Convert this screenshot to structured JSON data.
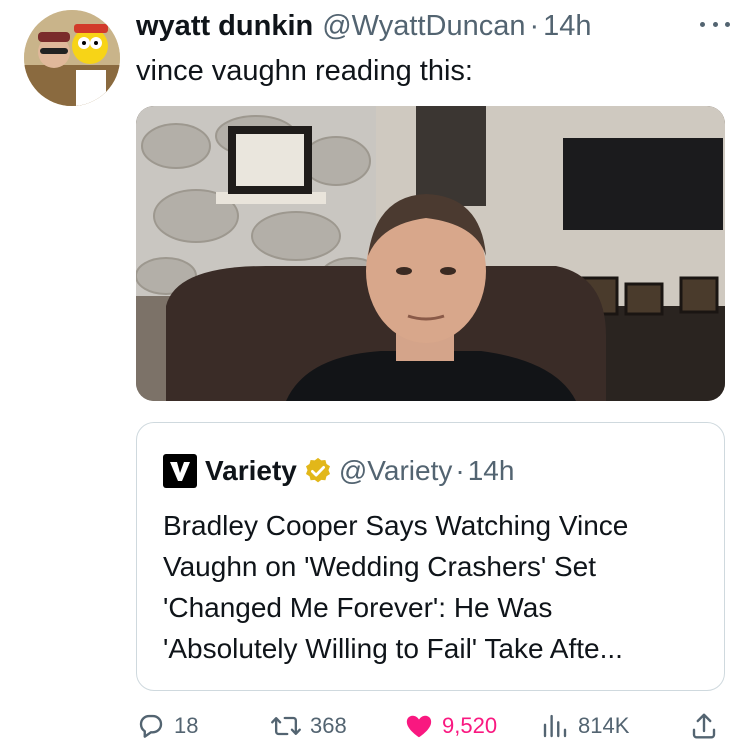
{
  "tweet": {
    "author_name": "wyatt dunkin",
    "author_handle": "@WyattDuncan",
    "separator": "·",
    "time": "14h",
    "text": "vince vaughn reading this:"
  },
  "quote": {
    "name": "Variety",
    "handle": "@Variety",
    "separator": "·",
    "time": "14h",
    "text_lines": [
      "Bradley Cooper Says Watching Vince",
      "Vaughn on 'Wedding Crashers' Set",
      "'Changed Me Forever': He Was",
      "'Absolutely Willing to Fail' Take Afte..."
    ]
  },
  "actions": {
    "replies": "18",
    "retweets": "368",
    "likes": "9,520",
    "views": "814K"
  },
  "colors": {
    "text": "#0f1419",
    "secondary": "#536471",
    "like": "#f91880",
    "verified": "#e2b719",
    "border": "#cfd9de"
  },
  "icons": [
    "more-icon",
    "variety-logo-icon",
    "verified-badge-icon",
    "reply-icon",
    "retweet-icon",
    "like-icon",
    "views-icon",
    "share-icon"
  ]
}
